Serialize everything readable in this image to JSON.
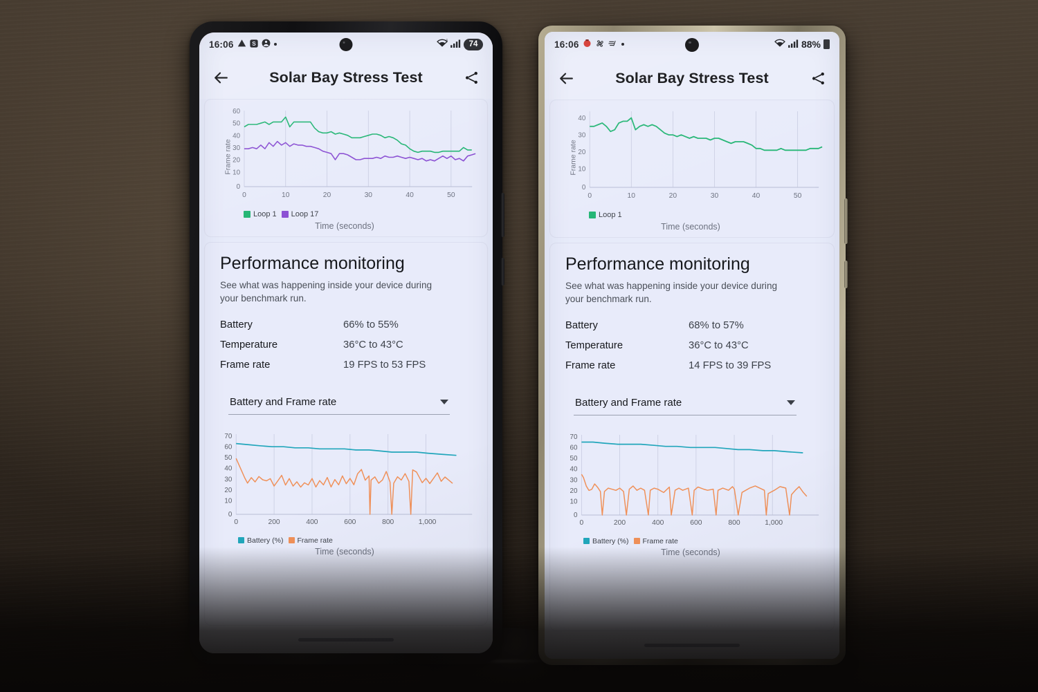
{
  "scene": {
    "background": "#3a322b",
    "description": "Two Android phones side by side on round stands showing 3DMark Solar Bay Stress Test results"
  },
  "phones": [
    {
      "id": "left",
      "frame_color": "#141416",
      "status_bar": {
        "time": "16:06",
        "left_icons": [
          "warning-triangle-icon",
          "s-badge-icon",
          "person-icon",
          "dot-icon"
        ],
        "right_icons": [
          "wifi-6-icon",
          "signal-bars-icon"
        ],
        "battery_text": "74",
        "battery_style": "pill"
      },
      "app_bar": {
        "back_icon": "back-arrow-icon",
        "title": "Solar Bay Stress Test",
        "share_icon": "share-icon"
      },
      "top_chart": {
        "ylabel": "Frame rate",
        "xlabel": "Time (seconds)",
        "legend": [
          {
            "label": "Loop 1",
            "color": "#22b573"
          },
          {
            "label": "Loop 17",
            "color": "#8a4fd3"
          }
        ]
      },
      "performance": {
        "title": "Performance monitoring",
        "subtitle": "See what was happening inside your device during your benchmark run.",
        "rows": [
          {
            "key": "Battery",
            "value": "66% to 55%"
          },
          {
            "key": "Temperature",
            "value": "36°C to 43°C"
          },
          {
            "key": "Frame rate",
            "value": "19 FPS to 53 FPS"
          }
        ],
        "dropdown_value": "Battery and Frame rate",
        "dropdown_icon": "chevron-down-icon"
      },
      "bottom_chart": {
        "xlabel": "Time (seconds)",
        "legend": [
          {
            "label": "Battery (%)",
            "color": "#21a6bb"
          },
          {
            "label": "Frame rate",
            "color": "#f09058"
          }
        ]
      }
    },
    {
      "id": "right",
      "frame_color": "#a9a18a",
      "status_bar": {
        "time": "16:06",
        "left_icons": [
          "red-alert-icon",
          "fan-icon",
          "speed-lines-icon",
          "dot-icon"
        ],
        "right_icons": [
          "wifi-icon",
          "signal-bars-icon"
        ],
        "battery_text": "88%",
        "battery_style": "text"
      },
      "app_bar": {
        "back_icon": "back-arrow-icon",
        "title": "Solar Bay Stress Test",
        "share_icon": "share-icon"
      },
      "top_chart": {
        "ylabel": "Frame rate",
        "xlabel": "Time (seconds)",
        "legend": [
          {
            "label": "Loop 1",
            "color": "#22b573"
          }
        ]
      },
      "performance": {
        "title": "Performance monitoring",
        "subtitle": "See what was happening inside your device during your benchmark run.",
        "rows": [
          {
            "key": "Battery",
            "value": "68% to 57%"
          },
          {
            "key": "Temperature",
            "value": "36°C to 43°C"
          },
          {
            "key": "Frame rate",
            "value": "14 FPS to 39 FPS"
          }
        ],
        "dropdown_value": "Battery and Frame rate",
        "dropdown_icon": "chevron-down-icon"
      },
      "bottom_chart": {
        "xlabel": "Time (seconds)",
        "legend": [
          {
            "label": "Battery (%)",
            "color": "#21a6bb"
          },
          {
            "label": "Frame rate",
            "color": "#f09058"
          }
        ]
      }
    }
  ],
  "chart_data": [
    {
      "id": "left-top",
      "type": "line",
      "title": "",
      "xlabel": "Time (seconds)",
      "ylabel": "Frame rate",
      "xlim": [
        0,
        58
      ],
      "ylim": [
        0,
        63
      ],
      "xticks": [
        0,
        10,
        20,
        30,
        40,
        50
      ],
      "yticks": [
        0,
        10,
        20,
        30,
        40,
        50,
        60
      ],
      "grid": "vertical",
      "legend_position": "bottom-left",
      "series": [
        {
          "name": "Loop 1",
          "color": "#22b573",
          "x": [
            0,
            1,
            2,
            3,
            4,
            5,
            6,
            7,
            8,
            9,
            10,
            11,
            12,
            13,
            14,
            15,
            16,
            17,
            18,
            19,
            20,
            21,
            22,
            23,
            24,
            25,
            26,
            27,
            28,
            29,
            30,
            31,
            32,
            33,
            34,
            35,
            36,
            37,
            38,
            39,
            40,
            41,
            42,
            43,
            44,
            45,
            46,
            47,
            48,
            49,
            50,
            51,
            52,
            53,
            54,
            55,
            56,
            57
          ],
          "values": [
            49,
            51,
            51,
            51,
            52,
            53,
            51,
            53,
            53,
            53,
            57,
            49,
            53,
            53,
            53,
            53,
            53,
            48,
            45,
            44,
            44,
            45,
            43,
            44,
            43,
            42,
            40,
            40,
            40,
            41,
            42,
            43,
            43,
            42,
            40,
            41,
            40,
            38,
            35,
            34,
            31,
            29,
            28,
            29,
            29,
            29,
            28,
            28,
            29,
            29,
            29,
            29,
            29,
            32,
            30,
            30,
            31,
            31
          ]
        },
        {
          "name": "Loop 17",
          "color": "#8a4fd3",
          "x": [
            0,
            1,
            2,
            3,
            4,
            5,
            6,
            7,
            8,
            9,
            10,
            11,
            12,
            13,
            14,
            15,
            16,
            17,
            18,
            19,
            20,
            21,
            22,
            23,
            24,
            25,
            26,
            27,
            28,
            29,
            30,
            31,
            32,
            33,
            34,
            35,
            36,
            37,
            38,
            39,
            40,
            41,
            42,
            43,
            44,
            45,
            46,
            47,
            48,
            49,
            50,
            51,
            52,
            53,
            54,
            55,
            56,
            57
          ],
          "values": [
            31,
            31,
            32,
            31,
            34,
            31,
            36,
            33,
            37,
            34,
            36,
            33,
            35,
            34,
            34,
            33,
            33,
            32,
            31,
            29,
            28,
            27,
            22,
            27,
            27,
            26,
            24,
            22,
            22,
            23,
            23,
            23,
            24,
            23,
            25,
            24,
            24,
            25,
            24,
            23,
            24,
            23,
            22,
            23,
            21,
            22,
            21,
            23,
            25,
            23,
            25,
            22,
            23,
            21,
            24,
            25,
            26,
            27
          ]
        }
      ]
    },
    {
      "id": "left-bottom",
      "type": "line",
      "title": "",
      "xlabel": "Time (seconds)",
      "ylabel": "",
      "xlim": [
        0,
        1160
      ],
      "ylim": [
        0,
        72
      ],
      "xticks": [
        0,
        200,
        400,
        600,
        800,
        1000
      ],
      "xticklabels": [
        "0",
        "200",
        "400",
        "600",
        "800",
        "1,000"
      ],
      "yticks": [
        0,
        10,
        20,
        30,
        40,
        50,
        60,
        70
      ],
      "grid": "vertical",
      "legend_position": "bottom-left",
      "series": [
        {
          "name": "Battery (%)",
          "color": "#21a6bb",
          "x": [
            0,
            60,
            120,
            190,
            250,
            310,
            380,
            440,
            500,
            570,
            630,
            700,
            760,
            820,
            880,
            950,
            1010,
            1080,
            1160
          ],
          "values": [
            66,
            65,
            64,
            63,
            63,
            62,
            62,
            61,
            61,
            61,
            60,
            60,
            59,
            58,
            58,
            58,
            57,
            56,
            55
          ]
        },
        {
          "name": "Frame rate",
          "color": "#f09058",
          "x": [
            0,
            15,
            30,
            45,
            60,
            80,
            100,
            120,
            140,
            160,
            180,
            200,
            220,
            240,
            260,
            280,
            300,
            320,
            340,
            360,
            380,
            400,
            420,
            440,
            460,
            480,
            500,
            520,
            540,
            560,
            580,
            600,
            620,
            640,
            660,
            680,
            700,
            710,
            720,
            740,
            760,
            780,
            800,
            820,
            830,
            840,
            860,
            880,
            900,
            920,
            940,
            950,
            960,
            980,
            1000,
            1020,
            1040,
            1060,
            1080,
            1100,
            1120,
            1140,
            1160
          ],
          "values": [
            52,
            46,
            40,
            34,
            29,
            34,
            30,
            35,
            32,
            31,
            33,
            26,
            31,
            36,
            27,
            33,
            26,
            30,
            25,
            29,
            27,
            33,
            25,
            31,
            27,
            33,
            25,
            32,
            27,
            35,
            28,
            33,
            27,
            36,
            40,
            30,
            34,
            0,
            30,
            33,
            25,
            28,
            34,
            24,
            0,
            23,
            30,
            27,
            33,
            25,
            29,
            0,
            35,
            34,
            25,
            30,
            25,
            30,
            33,
            26,
            31,
            29,
            25
          ]
        }
      ]
    },
    {
      "id": "right-top",
      "type": "line",
      "title": "",
      "xlabel": "Time (seconds)",
      "ylabel": "Frame rate",
      "xlim": [
        0,
        58
      ],
      "ylim": [
        0,
        44
      ],
      "xticks": [
        0,
        10,
        20,
        30,
        40,
        50
      ],
      "yticks": [
        0,
        10,
        20,
        30,
        40
      ],
      "grid": "vertical",
      "legend_position": "bottom-left",
      "series": [
        {
          "name": "Loop 1",
          "color": "#22b573",
          "x": [
            0,
            1,
            2,
            3,
            4,
            5,
            6,
            7,
            8,
            9,
            10,
            11,
            12,
            13,
            14,
            15,
            16,
            17,
            18,
            19,
            20,
            21,
            22,
            23,
            24,
            25,
            26,
            27,
            28,
            29,
            30,
            31,
            32,
            33,
            34,
            35,
            36,
            37,
            38,
            39,
            40,
            41,
            42,
            43,
            44,
            45,
            46,
            47,
            48,
            49,
            50,
            51,
            52,
            53,
            54,
            55,
            56,
            57
          ],
          "values": [
            36,
            36,
            37,
            38,
            36,
            33,
            34,
            38,
            39,
            39,
            41,
            34,
            36,
            37,
            36,
            37,
            36,
            34,
            32,
            31,
            31,
            30,
            31,
            30,
            29,
            30,
            29,
            29,
            29,
            28,
            29,
            29,
            28,
            27,
            26,
            27,
            27,
            27,
            26,
            25,
            23,
            23,
            22,
            22,
            22,
            22,
            23,
            22,
            22,
            22,
            22,
            22,
            22,
            23,
            23,
            23,
            23,
            24
          ]
        }
      ]
    },
    {
      "id": "right-bottom",
      "type": "line",
      "title": "",
      "xlabel": "Time (seconds)",
      "ylabel": "",
      "xlim": [
        0,
        1160
      ],
      "ylim": [
        0,
        72
      ],
      "xticks": [
        0,
        200,
        400,
        600,
        800,
        1000
      ],
      "xticklabels": [
        "0",
        "200",
        "400",
        "600",
        "800",
        "1,000"
      ],
      "yticks": [
        0,
        10,
        20,
        30,
        40,
        50,
        60,
        70
      ],
      "grid": "vertical",
      "legend_position": "bottom-left",
      "series": [
        {
          "name": "Battery (%)",
          "color": "#21a6bb",
          "x": [
            0,
            60,
            120,
            190,
            250,
            310,
            380,
            440,
            500,
            570,
            630,
            700,
            760,
            820,
            880,
            950,
            1010,
            1080,
            1160
          ],
          "values": [
            68,
            68,
            67,
            66,
            66,
            66,
            65,
            64,
            64,
            63,
            63,
            63,
            62,
            61,
            61,
            60,
            60,
            59,
            58
          ]
        },
        {
          "name": "Frame rate",
          "color": "#f09058",
          "x": [
            0,
            10,
            25,
            40,
            55,
            70,
            85,
            100,
            110,
            120,
            140,
            160,
            180,
            200,
            220,
            235,
            250,
            270,
            290,
            310,
            330,
            350,
            360,
            380,
            400,
            430,
            460,
            470,
            490,
            510,
            530,
            560,
            580,
            590,
            610,
            640,
            660,
            690,
            705,
            715,
            740,
            770,
            800,
            820,
            830,
            850,
            880,
            900,
            930,
            945,
            960,
            990,
            1020,
            1050,
            1065,
            1080,
            1100,
            1120,
            1140,
            1160
          ],
          "values": [
            38,
            35,
            27,
            23,
            24,
            29,
            26,
            22,
            0,
            22,
            25,
            24,
            23,
            25,
            22,
            0,
            23,
            26,
            22,
            24,
            22,
            0,
            22,
            25,
            24,
            21,
            26,
            0,
            22,
            25,
            22,
            25,
            0,
            22,
            26,
            24,
            23,
            24,
            0,
            22,
            25,
            22,
            26,
            23,
            0,
            21,
            25,
            27,
            22,
            0,
            19,
            23,
            26,
            27,
            0,
            18,
            22,
            26,
            21,
            17
          ]
        }
      ]
    }
  ]
}
